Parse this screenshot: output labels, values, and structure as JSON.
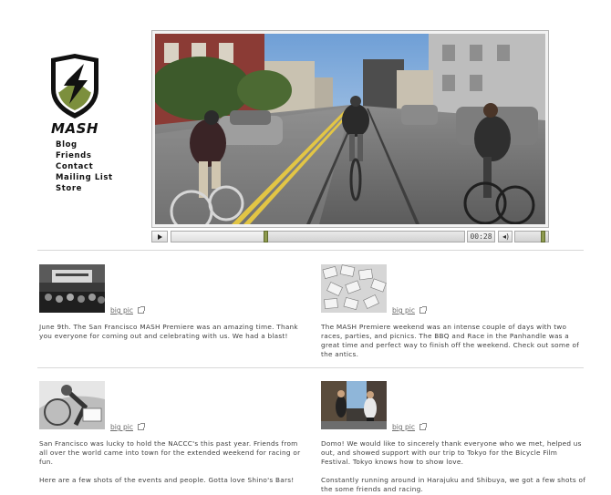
{
  "logo": {
    "wordmark": "MASH"
  },
  "nav": {
    "items": [
      {
        "label": "Blog"
      },
      {
        "label": "Friends"
      },
      {
        "label": "Contact"
      },
      {
        "label": "Mailing List"
      },
      {
        "label": "Store"
      }
    ]
  },
  "video": {
    "time": "00:28",
    "progress": 0.32,
    "volume": 0.9
  },
  "posts": [
    {
      "link": "big pic",
      "paragraphs": [
        "June 9th. The San Francisco MASH Premiere was an amazing time. Thank you everyone for coming out and celebrating with us. We had a blast!"
      ]
    },
    {
      "link": "big pic",
      "paragraphs": [
        "The MASH Premiere weekend was an intense couple of days with two races, parties, and picnics. The BBQ and Race in the Panhandle was a great time and perfect way to finish off the weekend. Check out some of the antics."
      ]
    },
    {
      "link": "big pic",
      "paragraphs": [
        "San Francisco was lucky to hold the NACCC's this past year. Friends from all over the world came into town for the extended weekend for racing or fun.",
        "Here are a few shots of the events and people. Gotta love Shino's Bars!"
      ]
    },
    {
      "link": "big pic",
      "paragraphs": [
        "Domo! We would like to sincerely thank everyone who we met, helped us out, and showed support with our trip to Tokyo for the Bicycle Film Festival. Tokyo knows how to show love.",
        "Constantly running around in Harajuku and Shibuya, we got a few shots of the some friends and racing."
      ]
    }
  ],
  "colors": {
    "accent": "#8d9a4e",
    "text": "#333333",
    "divider": "#d8d8d8"
  },
  "icons": [
    "mash-shield-logo",
    "play-icon",
    "volume-icon",
    "external-link-icon"
  ]
}
